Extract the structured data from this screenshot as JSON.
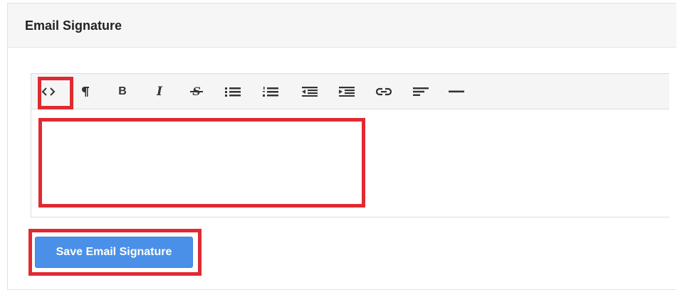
{
  "panel": {
    "title": "Email Signature"
  },
  "toolbar": {
    "buttons": [
      {
        "name": "code-view",
        "icon": "code-icon"
      },
      {
        "name": "paragraph",
        "icon": "paragraph-icon"
      },
      {
        "name": "bold",
        "icon": "bold-icon",
        "label": "B"
      },
      {
        "name": "italic",
        "icon": "italic-icon",
        "label": "I"
      },
      {
        "name": "strikethrough",
        "icon": "strikethrough-icon",
        "label": "S"
      },
      {
        "name": "unordered-list",
        "icon": "unordered-list-icon"
      },
      {
        "name": "ordered-list",
        "icon": "ordered-list-icon"
      },
      {
        "name": "outdent",
        "icon": "outdent-icon"
      },
      {
        "name": "indent",
        "icon": "indent-icon"
      },
      {
        "name": "link",
        "icon": "link-icon"
      },
      {
        "name": "align",
        "icon": "align-left-icon"
      },
      {
        "name": "horizontal-rule",
        "icon": "horizontal-rule-icon"
      }
    ]
  },
  "editor": {
    "content": ""
  },
  "save_button": {
    "label": "Save Email Signature"
  },
  "colors": {
    "accent": "#4a90e8",
    "highlight": "#e02a32",
    "header_bg": "#f6f6f6",
    "toolbar_bg": "#f5f5f5"
  }
}
